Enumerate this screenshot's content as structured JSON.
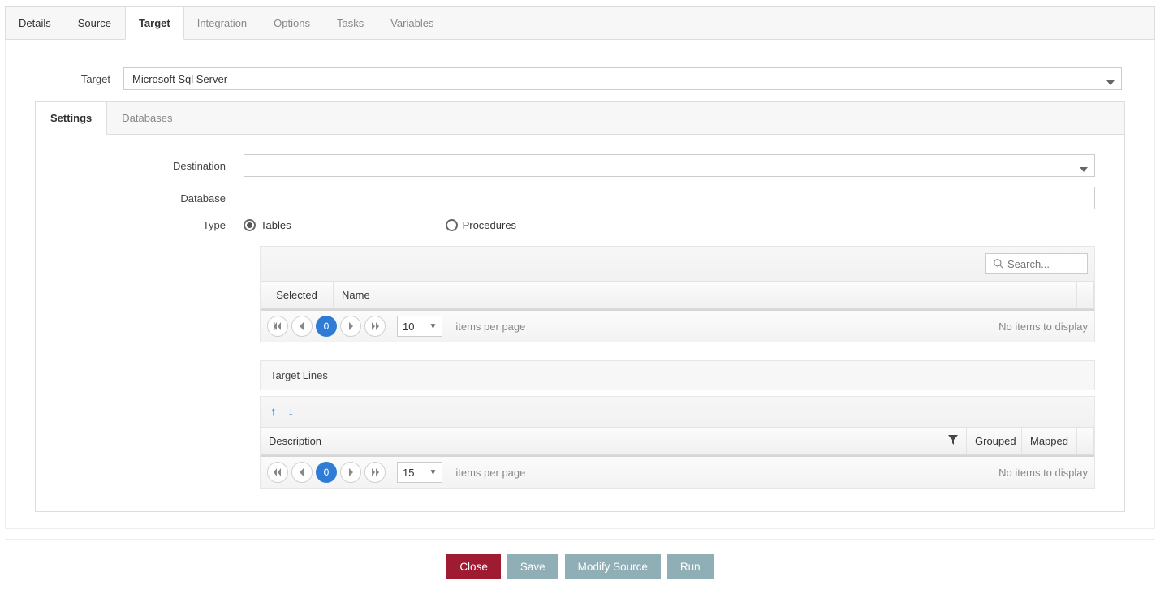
{
  "mainTabs": {
    "details": "Details",
    "source": "Source",
    "target": "Target",
    "integration": "Integration",
    "options": "Options",
    "tasks": "Tasks",
    "variables": "Variables"
  },
  "targetField": {
    "label": "Target",
    "value": "Microsoft Sql Server"
  },
  "subTabs": {
    "settings": "Settings",
    "databases": "Databases"
  },
  "settings": {
    "destination": {
      "label": "Destination",
      "value": ""
    },
    "database": {
      "label": "Database",
      "value": ""
    },
    "type": {
      "label": "Type",
      "option_tables": "Tables",
      "option_procedures": "Procedures"
    }
  },
  "grid1": {
    "search_placeholder": "Search...",
    "col_selected": "Selected",
    "col_name": "Name",
    "page_num": "0",
    "page_size": "10",
    "ipp": "items per page",
    "no_items": "No items to display"
  },
  "targetLines": {
    "title": "Target Lines",
    "col_description": "Description",
    "col_grouped": "Grouped",
    "col_mapped": "Mapped",
    "page_num": "0",
    "page_size": "15",
    "ipp": "items per page",
    "no_items": "No items to display"
  },
  "footer": {
    "close": "Close",
    "save": "Save",
    "modify_source": "Modify Source",
    "run": "Run"
  }
}
